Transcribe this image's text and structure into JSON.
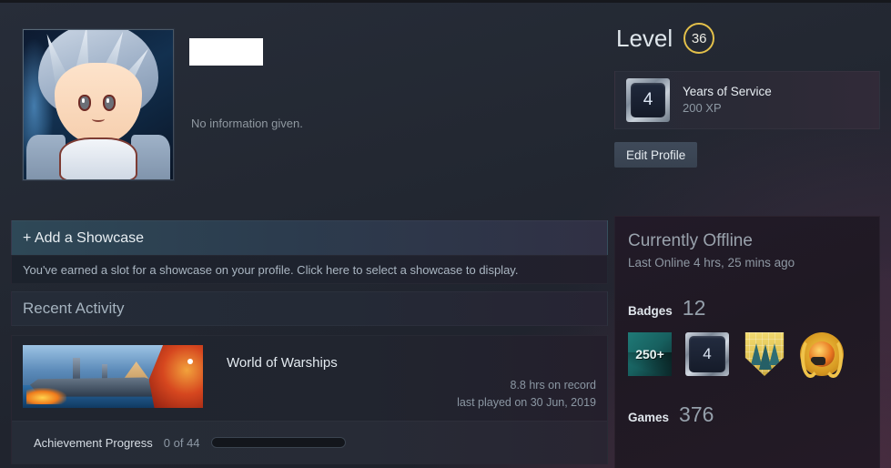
{
  "profile": {
    "avatar_alt": "anime-character-avatar",
    "persona_name_redacted": "",
    "summary": "No information given."
  },
  "showcase": {
    "add_label": "+ Add a Showcase",
    "hint": "You've earned a slot for a showcase on your profile. Click here to select a showcase to display."
  },
  "recent_activity": {
    "header": "Recent Activity",
    "games": [
      {
        "name": "World of Warships",
        "hours": "8.8 hrs on record",
        "last_played": "last played on 30 Jun, 2019",
        "achievement_label": "Achievement Progress",
        "achievement_count": "0 of 44",
        "achievement_percent": 0
      }
    ]
  },
  "level": {
    "label": "Level",
    "value": "36"
  },
  "years_of_service": {
    "badge_number": "4",
    "title": "Years of Service",
    "xp": "200 XP"
  },
  "edit_profile": {
    "label": "Edit Profile"
  },
  "status": {
    "title": "Currently Offline",
    "last_online": "Last Online 4 hrs, 25 mins ago"
  },
  "badges": {
    "label": "Badges",
    "count": "12",
    "items": [
      {
        "name": "badge-250-plus",
        "text": "250+"
      },
      {
        "name": "badge-years-of-service",
        "text": "4"
      },
      {
        "name": "badge-forest-shield",
        "text": ""
      },
      {
        "name": "badge-laurel-medal",
        "text": ""
      }
    ]
  },
  "games": {
    "label": "Games",
    "count": "376"
  },
  "colors": {
    "page_bg": "#1e222c",
    "accent_gold": "#e3c04a",
    "panel_right": "#221a28",
    "text_primary": "#c7d5e0",
    "text_muted": "#8b97a3"
  }
}
